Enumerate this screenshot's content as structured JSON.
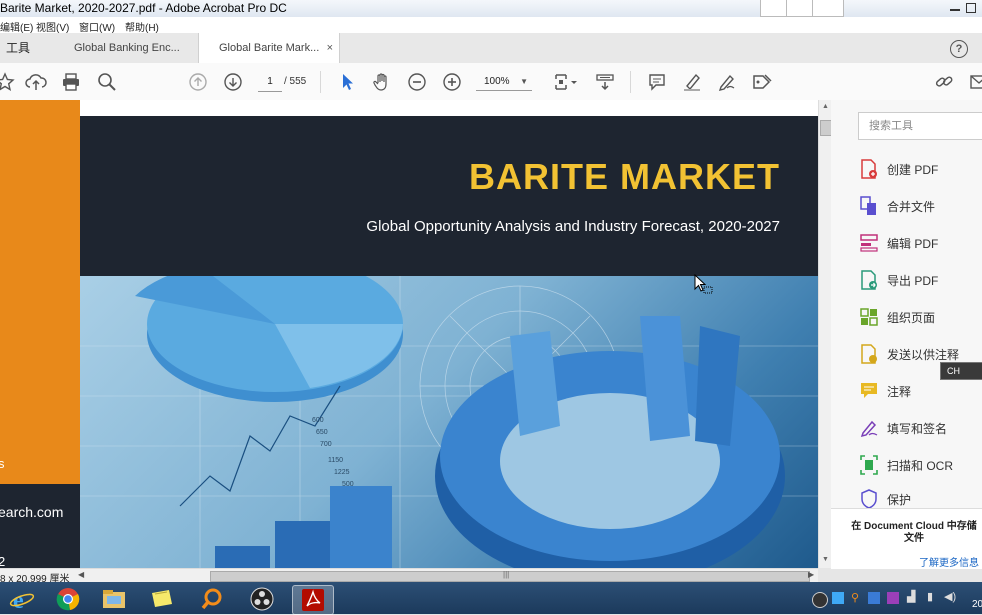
{
  "window": {
    "title": "Barite Market, 2020-2027.pdf - Adobe Acrobat Pro DC"
  },
  "menu": {
    "items": [
      "编辑(E)",
      "视图(V)",
      "窗口(W)",
      "帮助(H)"
    ]
  },
  "tabs": {
    "tools": "工具",
    "tab1": "Global Banking Enc...",
    "tab2": "Global Barite Mark...",
    "close": "×"
  },
  "toolbar": {
    "page_current": "1",
    "page_total": "/ 555",
    "zoom": "100%"
  },
  "document": {
    "headline": "BARITE MARKET",
    "subheadline": "Global Opportunity Analysis and Industry Forecast, 2020-2027",
    "left_text_1": "s",
    "left_text_2": "earch.com",
    "left_text_3": "2",
    "chart_labels": [
      "600",
      "650",
      "700",
      "1150",
      "1225",
      "500"
    ]
  },
  "status": {
    "page_size": "8 x 20.999 厘米"
  },
  "right_panel": {
    "search_placeholder": "搜索工具",
    "items": [
      "创建 PDF",
      "合并文件",
      "编辑 PDF",
      "导出 PDF",
      "组织页面",
      "发送以供注释",
      "注释",
      "填写和签名",
      "扫描和 OCR",
      "保护"
    ],
    "cloud_text": "在 Document Cloud 中存储文件",
    "learn_more": "了解更多信息"
  },
  "ime": {
    "label": "CH"
  },
  "clock": {
    "year": "20"
  },
  "colors": {
    "accent_orange": "#e8891a",
    "headline_yellow": "#f2c233",
    "banner_dark": "#1e2530"
  }
}
